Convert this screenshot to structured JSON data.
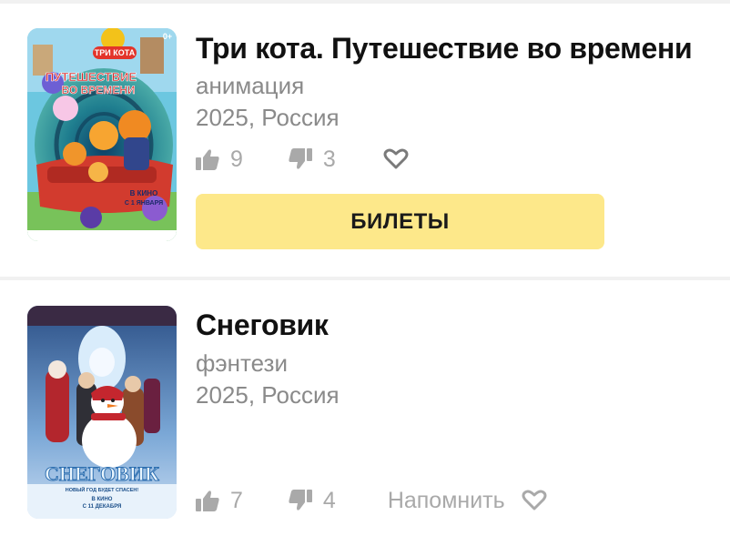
{
  "movies": [
    {
      "title": "Три кота. Путешествие во времени",
      "genre": "анимация",
      "year_country": "2025, Россия",
      "likes": "9",
      "dislikes": "3",
      "tickets_label": "БИЛЕТЫ",
      "poster": {
        "badge": "0+",
        "logo_text": "ТРИ КОТА",
        "headline_line1": "ПУТЕШЕСТВИЕ",
        "headline_line2": "ВО ВРЕМЕНИ",
        "release_line1": "В КИНО",
        "release_line2": "С 1 ЯНВАРЯ"
      }
    },
    {
      "title": "Снеговик",
      "genre": "фэнтези",
      "year_country": "2025, Россия",
      "likes": "7",
      "dislikes": "4",
      "remind_label": "Напомнить",
      "poster": {
        "logo_text": "СНЕГОВИК",
        "tagline": "НОВЫЙ ГОД БУДЕТ СПАСЕН!",
        "release_line1": "В КИНО",
        "release_line2": "С 11 ДЕКАБРЯ"
      }
    }
  ],
  "colors": {
    "accent_button": "#fde88a",
    "muted_text": "#8a8a8a",
    "icon_grey": "#a9a9a9",
    "divider": "#f1f1f1"
  },
  "icons": [
    "thumbs-up-icon",
    "thumbs-down-icon",
    "heart-icon"
  ]
}
